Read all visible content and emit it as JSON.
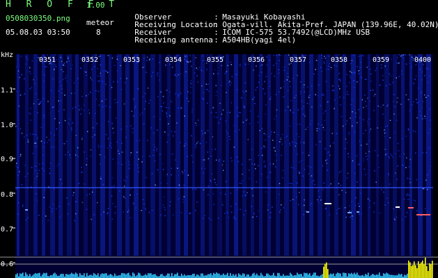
{
  "header": {
    "title": "H R O F F T",
    "version": "1.00",
    "filename": "0508030350.png",
    "datetime": "05.08.03 03:50",
    "meteor_label": "meteor",
    "meteor_count": "8"
  },
  "info": [
    {
      "key": "Observer",
      "sep": ":",
      "value": "Masayuki Kobayashi"
    },
    {
      "key": "Receiving Location",
      "sep": ":",
      "value": "Ogata-vill. Akita-Pref. JAPAN (139.96E, 40.02N)"
    },
    {
      "key": "Receiver",
      "sep": ":",
      "value": "ICOM IC-575 53.7492(@LCD)MHz USB"
    },
    {
      "key": "Receiving antenna",
      "sep": ":",
      "value": "A504HB(yagi 4el)"
    }
  ],
  "spectrogram": {
    "y_unit": "kHz",
    "y_ticks": [
      "1.1",
      "1.0",
      "0.9",
      "0.8",
      "0.7",
      "0.6"
    ],
    "time_labels": [
      "0351",
      "0352",
      "0353",
      "0354",
      "0355",
      "0356",
      "0357",
      "0358",
      "0359",
      "0400"
    ],
    "colors": {
      "background": "#000033",
      "noise": "#1a3cff",
      "noise_bright": "#6fa0ff",
      "carrier": "#3355ff",
      "meteor": "#ffffff",
      "meteor_warm": "#ff6060",
      "level": "#33ccff",
      "level_peak": "#ffff00"
    }
  }
}
